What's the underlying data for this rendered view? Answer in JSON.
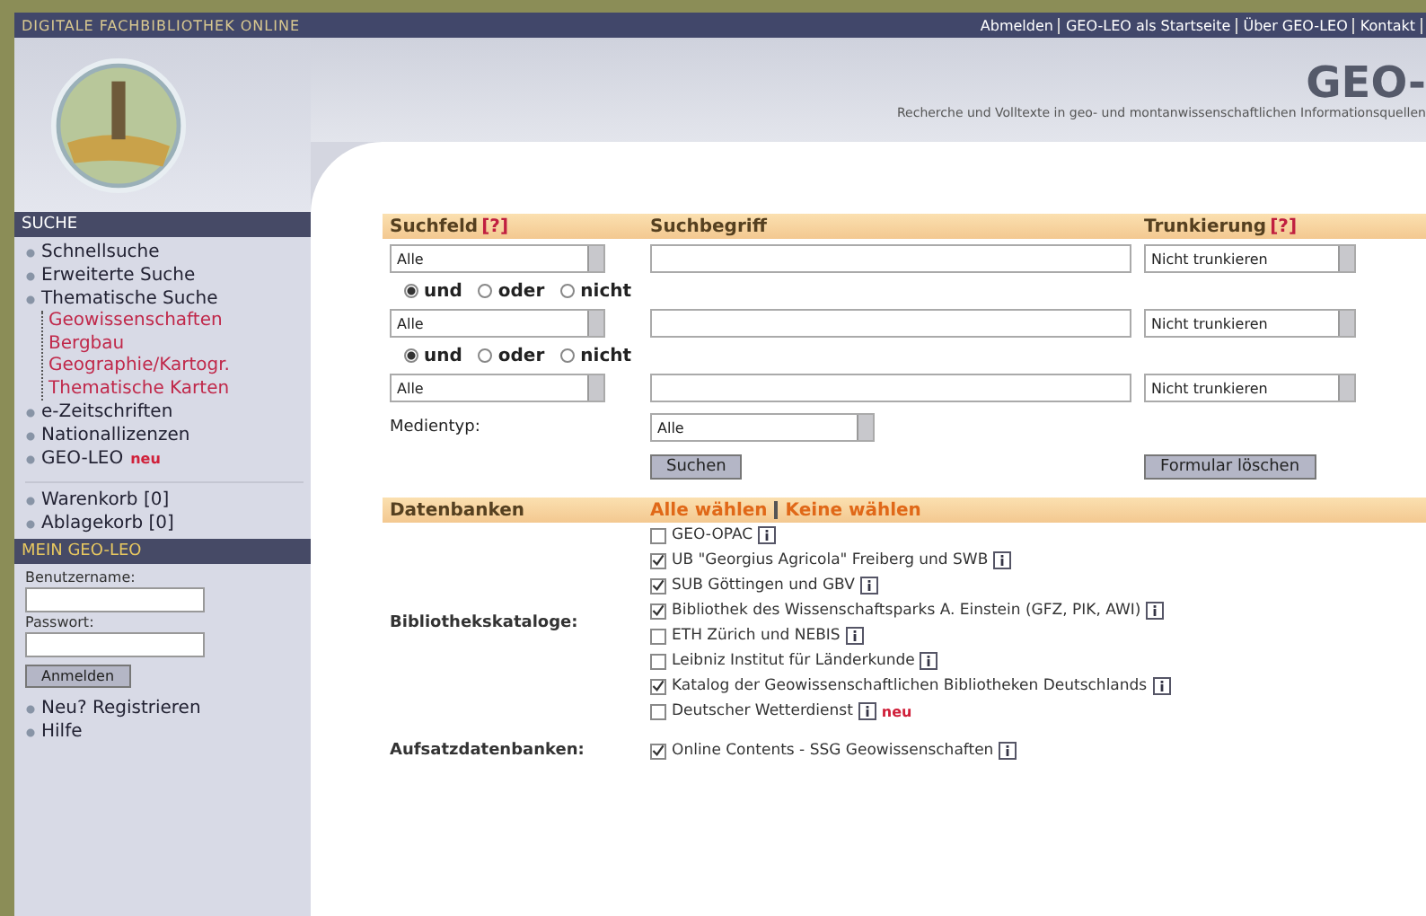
{
  "top_bar": {
    "tagline": "DIGITALE FACHBIBLIOTHEK ONLINE",
    "links": [
      "Abmelden",
      "GEO-LEO als Startseite",
      "Über GEO-LEO",
      "Kontakt"
    ]
  },
  "header": {
    "title": "GEO-",
    "subtitle": "Recherche und Volltexte in geo- und montanwissenschaftlichen Informationsquellen"
  },
  "sidebar": {
    "search_heading": "SUCHE",
    "items": [
      {
        "label": "Schnellsuche"
      },
      {
        "label": "Erweiterte Suche"
      },
      {
        "label": "Thematische Suche",
        "children": [
          {
            "label": "Geowissenschaften"
          },
          {
            "label": "Bergbau"
          },
          {
            "label": "Geographie/Kartogr."
          },
          {
            "label": "Thematische Karten"
          }
        ]
      },
      {
        "label": "e-Zeitschriften"
      },
      {
        "label": "Nationallizenzen"
      },
      {
        "label": "GEO-LEO",
        "badge": "neu"
      }
    ],
    "baskets": [
      "Warenkorb [0]",
      "Ablagekorb [0]"
    ],
    "login_heading": "MEIN GEO-LEO",
    "username_label": "Benutzername:",
    "password_label": "Passwort:",
    "login_button": "Anmelden",
    "bottom_items": [
      "Neu? Registrieren",
      "Hilfe"
    ]
  },
  "form": {
    "headers": {
      "field": "Suchfeld",
      "term": "Suchbegriff",
      "trunc": "Trunkierung",
      "help": "[?]"
    },
    "rows": [
      {
        "field": "Alle",
        "trunc": "Nicht trunkieren"
      },
      {
        "field": "Alle",
        "trunc": "Nicht trunkieren"
      },
      {
        "field": "Alle",
        "trunc": "Nicht trunkieren"
      }
    ],
    "operators": [
      [
        {
          "label": "und",
          "selected": true
        },
        {
          "label": "oder",
          "selected": false
        },
        {
          "label": "nicht",
          "selected": false
        }
      ],
      [
        {
          "label": "und",
          "selected": true
        },
        {
          "label": "oder",
          "selected": false
        },
        {
          "label": "nicht",
          "selected": false
        }
      ]
    ],
    "media_label": "Medientyp:",
    "media_value": "Alle",
    "search_button": "Suchen",
    "reset_button": "Formular löschen"
  },
  "databases": {
    "heading": "Datenbanken",
    "select_all": "Alle wählen",
    "select_none": "Keine wählen",
    "groups": [
      {
        "label": "Bibliothekskataloge:",
        "items": [
          {
            "label": "GEO-OPAC",
            "checked": false
          },
          {
            "label": "UB \"Georgius Agricola\" Freiberg und SWB",
            "checked": true
          },
          {
            "label": "SUB Göttingen und GBV",
            "checked": true
          },
          {
            "label": "Bibliothek des Wissenschaftsparks A. Einstein (GFZ, PIK, AWI)",
            "checked": true
          },
          {
            "label": "ETH Zürich und NEBIS",
            "checked": false
          },
          {
            "label": "Leibniz Institut für Länderkunde",
            "checked": false
          },
          {
            "label": "Katalog der Geowissenschaftlichen Bibliotheken Deutschlands",
            "checked": true
          },
          {
            "label": "Deutscher Wetterdienst",
            "checked": false,
            "badge": "neu"
          }
        ]
      },
      {
        "label": "Aufsatzdatenbanken:",
        "items": [
          {
            "label": "Online Contents - SSG Geowissenschaften",
            "checked": true
          }
        ]
      }
    ]
  }
}
